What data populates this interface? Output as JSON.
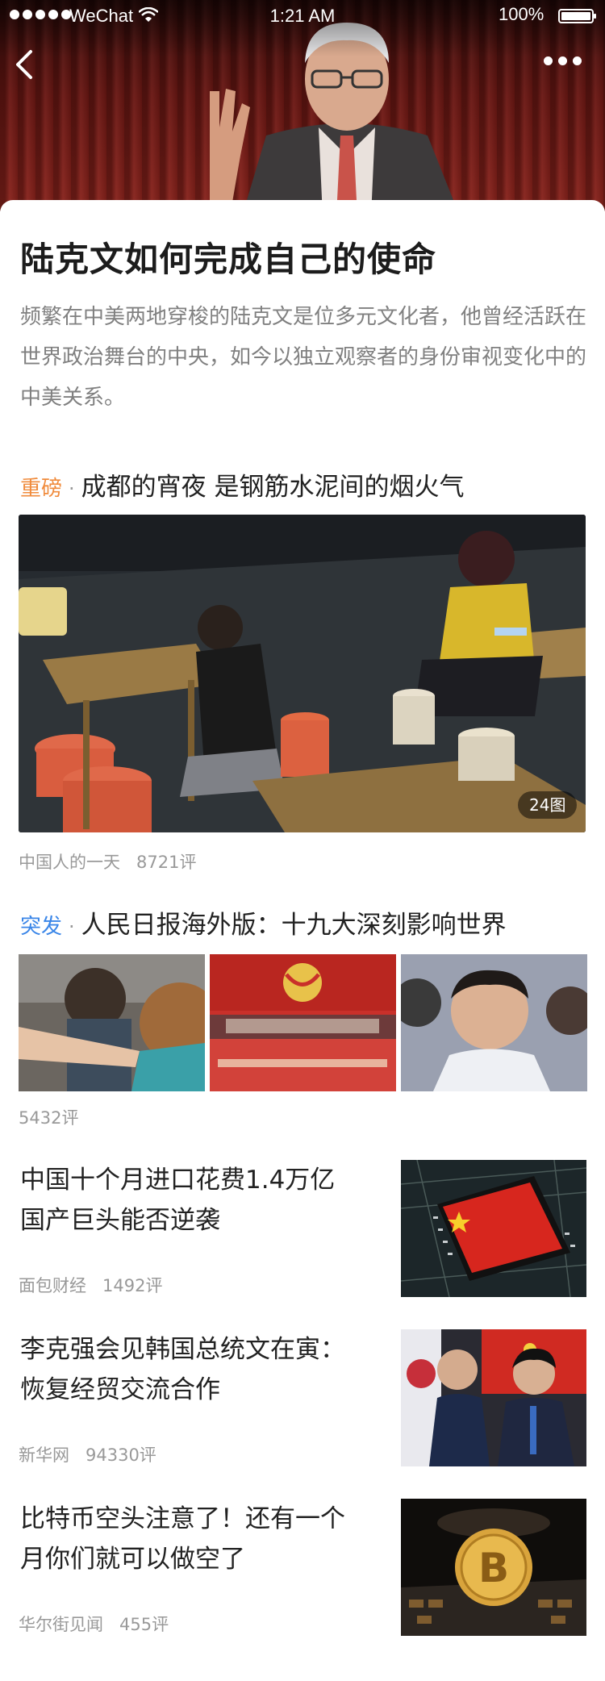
{
  "status_bar": {
    "carrier": "WeChat",
    "time": "1:21 AM",
    "battery": "100%"
  },
  "hero": {
    "back_icon": "chevron-left-icon",
    "more_icon": "more-dots-icon"
  },
  "topic": {
    "title": "陆克文如何完成自己的使命",
    "description": "频繁在中美两地穿梭的陆克文是位多元文化者，他曾经活跃在世界政治舞台的中央，如今以独立观察者的身份审视变化中的中美关系。"
  },
  "articles": [
    {
      "tag": "重磅",
      "tag_color": "#f08b3c",
      "title": "成都的宵夜 是钢筋水泥间的烟火气",
      "photo_count": "24图",
      "source": "中国人的一天",
      "comments": "8721评"
    },
    {
      "tag": "突发",
      "tag_color": "#3a86e8",
      "title": "人民日报海外版：十九大深刻影响世界",
      "comments": "5432评"
    },
    {
      "title": "中国十个月进口花费1.4万亿 国产巨头能否逆袭",
      "source": "面包财经",
      "comments": "1492评"
    },
    {
      "title": "李克强会见韩国总统文在寅：恢复经贸交流合作",
      "source": "新华网",
      "comments": "94330评"
    },
    {
      "title": "比特币空头注意了！还有一个月你们就可以做空了",
      "source": "华尔街见闻",
      "comments": "455评"
    }
  ],
  "bullet_separator": "·"
}
